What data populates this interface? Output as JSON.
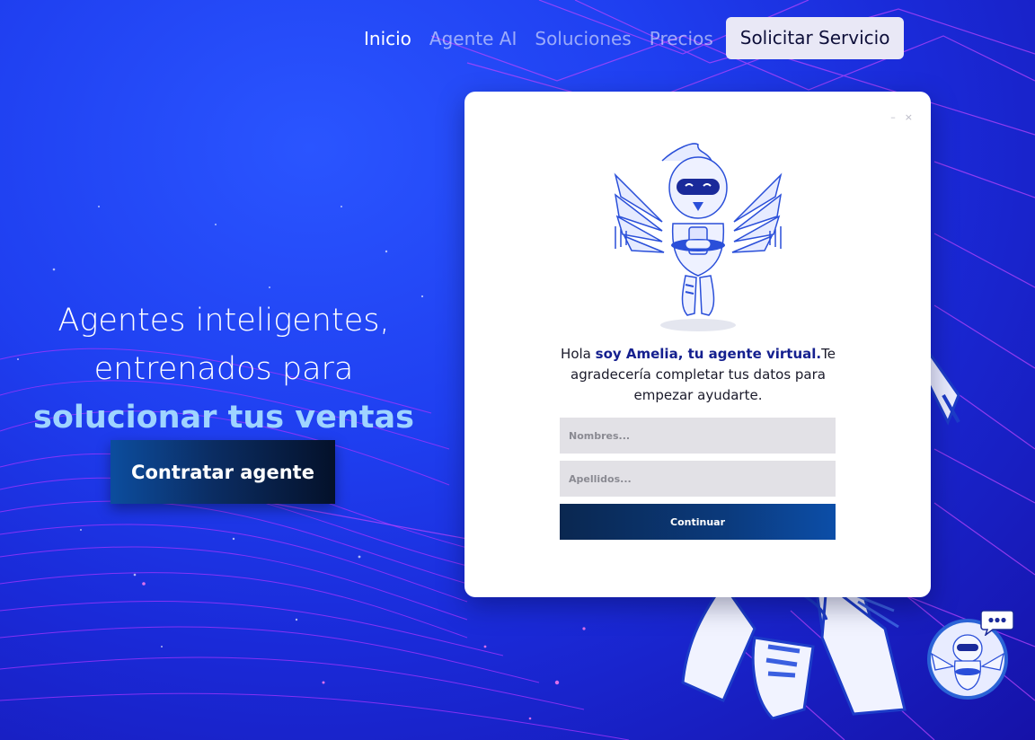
{
  "nav": {
    "items": [
      {
        "label": "Inicio",
        "active": true
      },
      {
        "label": "Agente AI",
        "active": false
      },
      {
        "label": "Soluciones",
        "active": false
      },
      {
        "label": "Precios",
        "active": false
      }
    ],
    "cta_label": "Solicitar Servicio"
  },
  "hero": {
    "line1": "Agentes inteligentes,",
    "line2": "entrenados para",
    "accent": "solucionar tus ventas",
    "button_label": "Contratar agente"
  },
  "modal": {
    "controls": {
      "minimize": "–",
      "close": "×"
    },
    "message_pre": "Hola ",
    "message_bold": "soy Amelia, tu agente virtual.",
    "message_post": "Te agradecería completar tus datos para empezar ayudarte.",
    "first_name_placeholder": "Nombres...",
    "last_name_placeholder": "Apellidos...",
    "continue_label": "Continuar"
  },
  "chat_widget": {
    "icon": "chat-dots-icon"
  },
  "colors": {
    "accent_text": "#9fd4ff",
    "brand_navy": "#15208f",
    "button_navy": "#0b2d63",
    "background_blue": "#1f3ff0",
    "laser_purple": "#b333ff"
  }
}
